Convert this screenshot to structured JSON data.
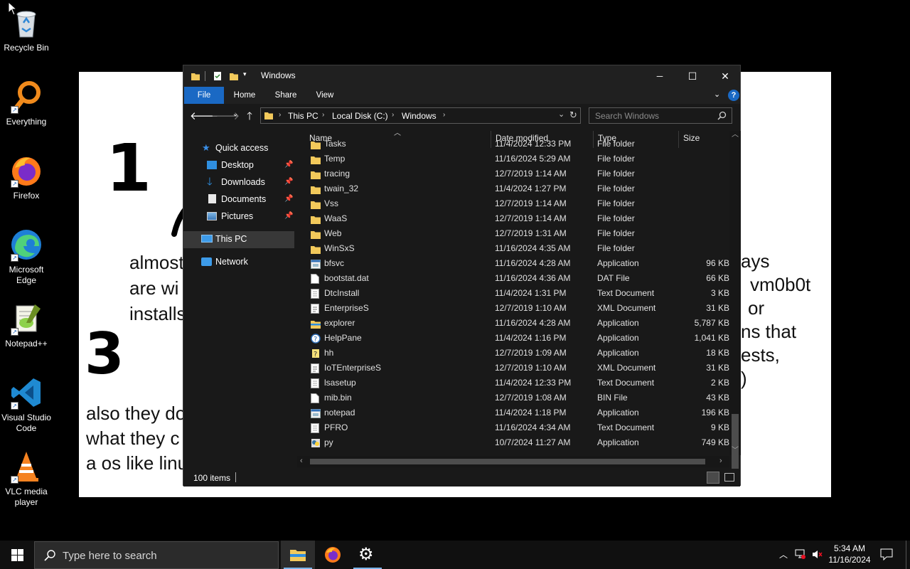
{
  "desktop": {
    "icons": [
      {
        "label": "Recycle Bin",
        "icon": "recycle-bin-icon"
      },
      {
        "label": "Everything",
        "icon": "everything-search-icon"
      },
      {
        "label": "Firefox",
        "icon": "firefox-icon"
      },
      {
        "label": "Microsoft Edge",
        "icon": "edge-icon"
      },
      {
        "label": "Notepad++",
        "icon": "notepad-plus-plus-icon"
      },
      {
        "label": "Visual Studio Code",
        "icon": "vscode-icon"
      },
      {
        "label": "VLC media player",
        "icon": "vlc-icon"
      }
    ]
  },
  "whiteboard": {
    "glyph_1": "1 C",
    "glyph_3": "3",
    "left_lines": [
      "almost",
      "are wi",
      "installs"
    ],
    "right_lines": [
      "ays",
      "vm0b0t",
      "or",
      "ns that",
      "ests,",
      ")"
    ],
    "bottom_lines": [
      "also they do",
      "what they c",
      "a os like linu"
    ]
  },
  "explorer": {
    "title": "Windows",
    "controls": {
      "minimize": "─",
      "maximize": "☐",
      "close": "✕"
    },
    "ribbon_tabs": [
      "File",
      "Home",
      "Share",
      "View"
    ],
    "help": "?",
    "breadcrumb": [
      "This PC",
      "Local Disk (C:)",
      "Windows"
    ],
    "search_placeholder": "Search Windows",
    "nav": {
      "quick_access": "Quick access",
      "pinned": [
        "Desktop",
        "Downloads",
        "Documents",
        "Pictures"
      ],
      "this_pc": "This PC",
      "network": "Network"
    },
    "columns": [
      "Name",
      "Date modified",
      "Type",
      "Size"
    ],
    "files": [
      {
        "name": "Tasks",
        "date": "11/4/2024 12:33 PM",
        "type": "File folder",
        "size": "",
        "icon": "folder-icon"
      },
      {
        "name": "Temp",
        "date": "11/16/2024 5:29 AM",
        "type": "File folder",
        "size": "",
        "icon": "folder-icon"
      },
      {
        "name": "tracing",
        "date": "12/7/2019 1:14 AM",
        "type": "File folder",
        "size": "",
        "icon": "folder-icon"
      },
      {
        "name": "twain_32",
        "date": "11/4/2024 1:27 PM",
        "type": "File folder",
        "size": "",
        "icon": "folder-icon"
      },
      {
        "name": "Vss",
        "date": "12/7/2019 1:14 AM",
        "type": "File folder",
        "size": "",
        "icon": "folder-icon"
      },
      {
        "name": "WaaS",
        "date": "12/7/2019 1:14 AM",
        "type": "File folder",
        "size": "",
        "icon": "folder-icon"
      },
      {
        "name": "Web",
        "date": "12/7/2019 1:31 AM",
        "type": "File folder",
        "size": "",
        "icon": "folder-icon"
      },
      {
        "name": "WinSxS",
        "date": "11/16/2024 4:35 AM",
        "type": "File folder",
        "size": "",
        "icon": "folder-icon"
      },
      {
        "name": "bfsvc",
        "date": "11/16/2024 4:28 AM",
        "type": "Application",
        "size": "96 KB",
        "icon": "application-icon"
      },
      {
        "name": "bootstat.dat",
        "date": "11/16/2024 4:36 AM",
        "type": "DAT File",
        "size": "66 KB",
        "icon": "file-icon"
      },
      {
        "name": "DtcInstall",
        "date": "11/4/2024 1:31 PM",
        "type": "Text Document",
        "size": "3 KB",
        "icon": "text-file-icon"
      },
      {
        "name": "EnterpriseS",
        "date": "12/7/2019 1:10 AM",
        "type": "XML Document",
        "size": "31 KB",
        "icon": "xml-file-icon"
      },
      {
        "name": "explorer",
        "date": "11/16/2024 4:28 AM",
        "type": "Application",
        "size": "5,787 KB",
        "icon": "explorer-app-icon"
      },
      {
        "name": "HelpPane",
        "date": "11/4/2024 1:16 PM",
        "type": "Application",
        "size": "1,041 KB",
        "icon": "help-icon"
      },
      {
        "name": "hh",
        "date": "12/7/2019 1:09 AM",
        "type": "Application",
        "size": "18 KB",
        "icon": "hh-help-icon"
      },
      {
        "name": "IoTEnterpriseS",
        "date": "12/7/2019 1:10 AM",
        "type": "XML Document",
        "size": "31 KB",
        "icon": "xml-file-icon"
      },
      {
        "name": "lsasetup",
        "date": "11/4/2024 12:33 PM",
        "type": "Text Document",
        "size": "2 KB",
        "icon": "text-file-icon"
      },
      {
        "name": "mib.bin",
        "date": "12/7/2019 1:08 AM",
        "type": "BIN File",
        "size": "43 KB",
        "icon": "file-icon"
      },
      {
        "name": "notepad",
        "date": "11/4/2024 1:18 PM",
        "type": "Application",
        "size": "196 KB",
        "icon": "application-icon"
      },
      {
        "name": "PFRO",
        "date": "11/16/2024 4:34 AM",
        "type": "Text Document",
        "size": "9 KB",
        "icon": "text-file-icon"
      },
      {
        "name": "py",
        "date": "10/7/2024 11:27 AM",
        "type": "Application",
        "size": "749 KB",
        "icon": "python-launcher-icon"
      }
    ],
    "status": "100 items"
  },
  "taskbar": {
    "search_placeholder": "Type here to search",
    "apps": [
      "file-explorer-icon",
      "firefox-icon",
      "settings-gear-icon"
    ],
    "time": "5:34 AM",
    "date": "11/16/2024"
  }
}
